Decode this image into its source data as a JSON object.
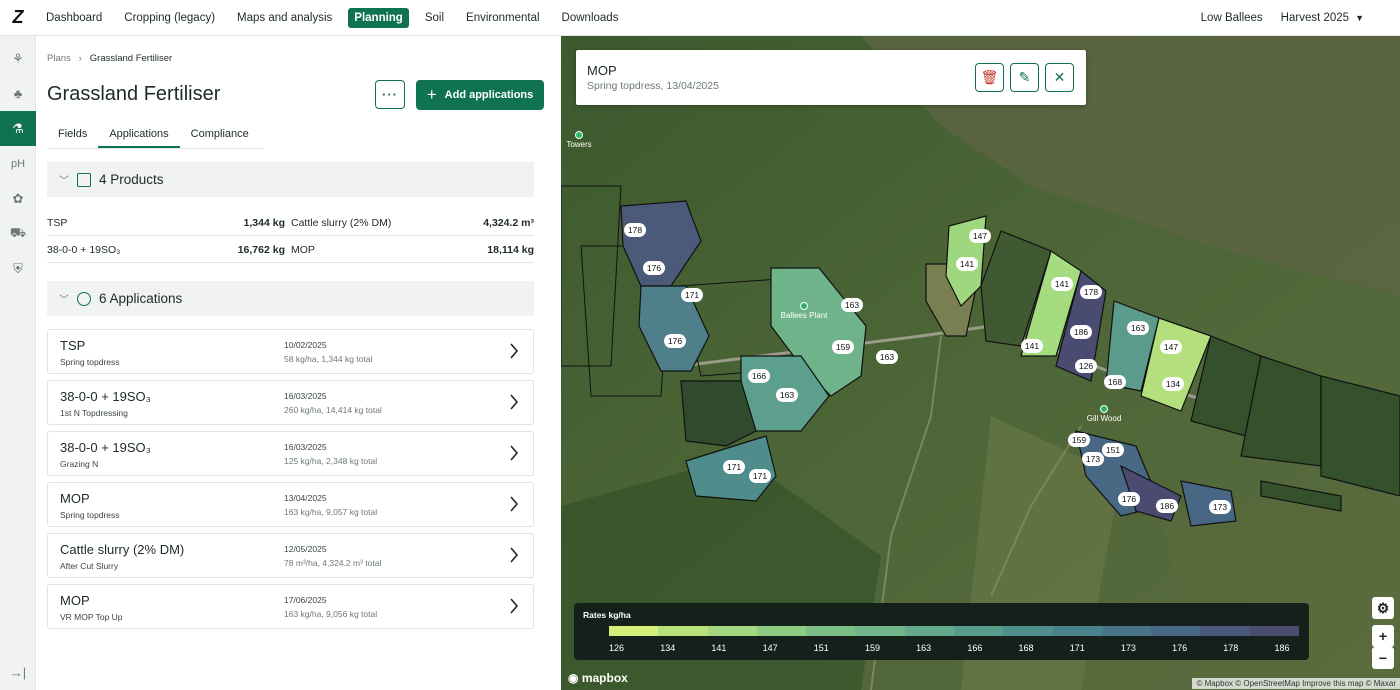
{
  "nav": {
    "logo": "Z",
    "items": [
      {
        "label": "Dashboard",
        "active": false
      },
      {
        "label": "Cropping (legacy)",
        "active": false
      },
      {
        "label": "Maps and analysis",
        "active": false
      },
      {
        "label": "Planning",
        "active": true
      },
      {
        "label": "Soil",
        "active": false
      },
      {
        "label": "Environmental",
        "active": false
      },
      {
        "label": "Downloads",
        "active": false
      }
    ],
    "farm": "Low Ballees",
    "harvest": "Harvest 2025"
  },
  "rail": {
    "items": [
      {
        "icon": "crop-icon",
        "glyph": "⚘"
      },
      {
        "icon": "sprout-icon",
        "glyph": "♣"
      },
      {
        "icon": "flask-icon",
        "glyph": "⚗"
      },
      {
        "icon": "ph-icon",
        "glyph": "pH"
      },
      {
        "icon": "puzzle-icon",
        "glyph": "✿"
      },
      {
        "icon": "tractor-icon",
        "glyph": "⛟"
      },
      {
        "icon": "shield-icon",
        "glyph": "⛨"
      }
    ],
    "collapse_glyph": "→|"
  },
  "breadcrumb": {
    "root": "Plans",
    "current": "Grassland Fertiliser"
  },
  "page": {
    "title": "Grassland Fertiliser",
    "more_label": "···",
    "add_label": "Add applications"
  },
  "tabs": [
    "Fields",
    "Applications",
    "Compliance"
  ],
  "products": {
    "heading": "4 Products",
    "items": [
      {
        "name": "TSP",
        "amount": "1,344 kg"
      },
      {
        "name": "Cattle slurry (2% DM)",
        "amount": "4,324.2 m³"
      },
      {
        "name": "38-0-0 + 19SO₃",
        "amount": "16,762 kg"
      },
      {
        "name": "MOP",
        "amount": "18,114 kg"
      }
    ]
  },
  "applications": {
    "heading": "6 Applications",
    "items": [
      {
        "name": "TSP",
        "sub": "Spring topdress",
        "date": "10/02/2025",
        "rate": "58 kg/ha, 1,344 kg total"
      },
      {
        "name": "38-0-0 + 19SO₃",
        "sub": "1st N Topdressing",
        "date": "16/03/2025",
        "rate": "260 kg/ha, 14,414 kg total"
      },
      {
        "name": "38-0-0 + 19SO₃",
        "sub": "Grazing N",
        "date": "16/03/2025",
        "rate": "125 kg/ha, 2,348 kg total"
      },
      {
        "name": "MOP",
        "sub": "Spring topdress",
        "date": "13/04/2025",
        "rate": "163 kg/ha, 9,057 kg total"
      },
      {
        "name": "Cattle slurry (2% DM)",
        "sub": "After Cut Slurry",
        "date": "12/05/2025",
        "rate": "78 m³/ha, 4,324.2 m³ total"
      },
      {
        "name": "MOP",
        "sub": "VR MOP Top Up",
        "date": "17/06/2025",
        "rate": "163 kg/ha, 9,056 kg total"
      }
    ]
  },
  "popup": {
    "title": "MOP",
    "subtitle": "Spring topdress, 13/04/2025"
  },
  "map": {
    "place_labels": [
      "Ballees Plant",
      "Gill Wood",
      "Towers"
    ],
    "field_rates": [
      "178",
      "176",
      "171",
      "176",
      "163",
      "159",
      "163",
      "166",
      "163",
      "171",
      "171",
      "147",
      "141",
      "141",
      "178",
      "186",
      "141",
      "126",
      "163",
      "168",
      "147",
      "134",
      "159",
      "151",
      "173",
      "176",
      "186",
      "173"
    ],
    "mapbox_label": "mapbox",
    "attribution": "© Mapbox © OpenStreetMap  Improve this map © Maxar",
    "controls": {
      "settings": "⚙",
      "zoom_in": "+",
      "zoom_out": "−"
    }
  },
  "legend": {
    "title": "Rates kg/ha",
    "ticks": [
      "126",
      "134",
      "141",
      "147",
      "151",
      "159",
      "163",
      "166",
      "168",
      "171",
      "173",
      "176",
      "178",
      "186"
    ],
    "colors": [
      "#d6ef7a",
      "#b7e27a",
      "#a3d87e",
      "#8dcc82",
      "#7cbf86",
      "#70b48a",
      "#64a98b",
      "#589c8c",
      "#4f908c",
      "#4a838c",
      "#487589",
      "#486784",
      "#4a587c",
      "#4b4a71"
    ]
  }
}
